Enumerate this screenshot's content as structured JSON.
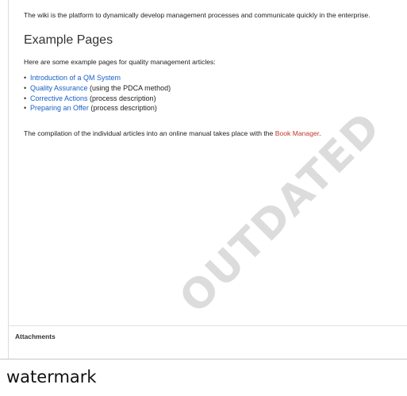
{
  "content": {
    "intro": "The wiki is the platform to dynamically develop management processes and communicate quickly in the enterprise.",
    "heading": "Example Pages",
    "subtext": "Here are some example pages for quality management articles:",
    "examples": [
      {
        "link": "Introduction of a QM System",
        "suffix": ""
      },
      {
        "link": "Quality Assurance",
        "suffix": " (using the PDCA method)"
      },
      {
        "link": "Corrective Actions",
        "suffix": " (process description)"
      },
      {
        "link": "Preparing an Offer",
        "suffix": " (process description)"
      }
    ],
    "outro_prefix": "The compilation of the individual articles into an online manual takes place with the ",
    "outro_link": "Book Manager",
    "outro_suffix": ".",
    "watermark": "OUTDATED"
  },
  "attachments": {
    "label": "Attachments"
  },
  "caption": "watermark",
  "colors": {
    "link": "#1a5fc7",
    "redlink": "#c0392b",
    "watermark": "#dcdcdc"
  },
  "bullet": "•"
}
